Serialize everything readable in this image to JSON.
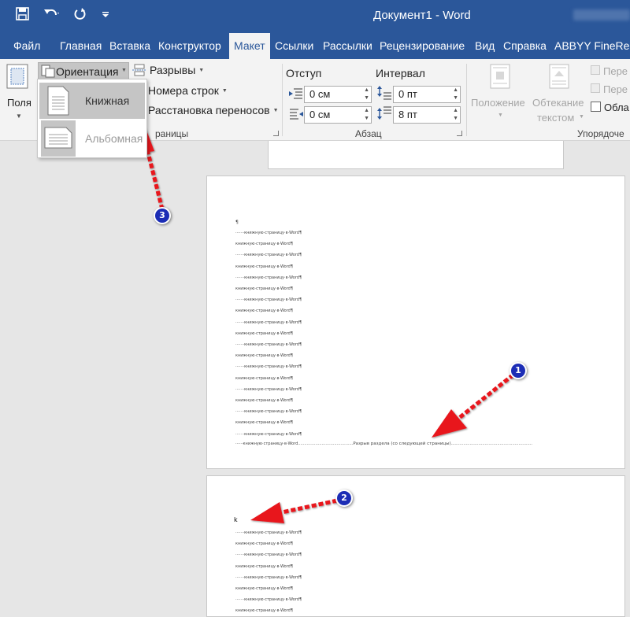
{
  "window": {
    "title": "Документ1  -  Word"
  },
  "quick_access": {
    "save_icon": "save-icon",
    "undo_icon": "undo-icon",
    "redo_icon": "redo-icon",
    "customize_icon": "chevron-down-icon"
  },
  "tabs": [
    "Файл",
    "Главная",
    "Вставка",
    "Конструктор",
    "Макет",
    "Ссылки",
    "Рассылки",
    "Рецензирование",
    "Вид",
    "Справка",
    "ABBYY FineReader"
  ],
  "active_tab": "Макет",
  "ribbon": {
    "margins_label": "Поля",
    "orientation_label": "Ориентация",
    "breaks_label": "Разрывы",
    "line_numbers_label": "Номера строк",
    "hyphenation_label": "Расстановка переносов",
    "page_setup_group": "раницы",
    "indent_label": "Отступ",
    "spacing_label": "Интервал",
    "indent_left": "0 см",
    "indent_right": "0 см",
    "spacing_before": "0 пт",
    "spacing_after": "8 пт",
    "paragraph_group": "Абзац",
    "position_label": "Положение",
    "wrap_label_1": "Обтекание",
    "wrap_label_2": "текстом",
    "forward_label": "Пере",
    "backward_label": "Пере",
    "area_label": "Обла",
    "arrange_group": "Упорядоче"
  },
  "orientation_menu": {
    "portrait": "Книжная",
    "landscape": "Альбомная"
  },
  "document": {
    "empty_para": "¶",
    "line_text": "книжную·страницу·в·Word¶",
    "section_break_text": "Разрыв раздела (со следующей страницы)",
    "cursor_char": "k"
  },
  "badges": [
    "1",
    "2",
    "3"
  ],
  "colors": {
    "word_blue": "#2b579a",
    "arrow_red": "#e8141c",
    "badge_blue": "#1c2db5"
  }
}
